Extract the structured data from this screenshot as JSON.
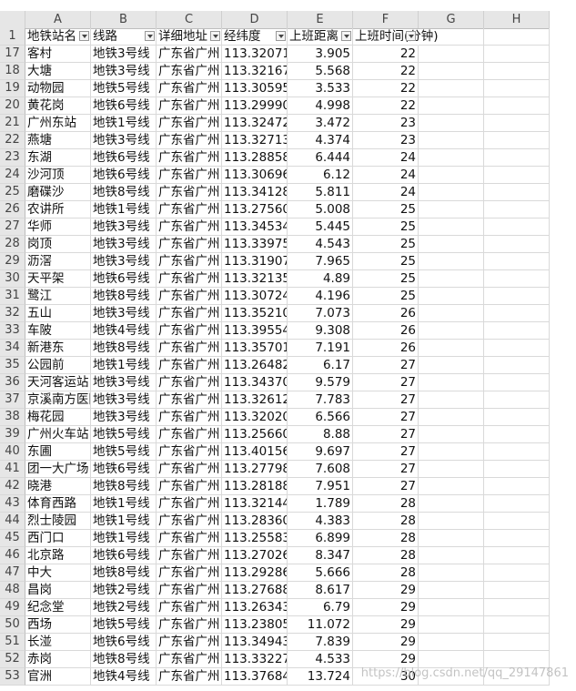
{
  "columns": [
    "A",
    "B",
    "C",
    "D",
    "E",
    "F",
    "G",
    "H"
  ],
  "header_row": {
    "row_number": "1",
    "cells": [
      "地铁站名",
      "线路",
      "详细地址",
      "经纬度",
      "上班距离",
      "上班时间(分钟)"
    ]
  },
  "rows": [
    {
      "n": "17",
      "name": "客村",
      "line": "地铁3号线",
      "addr": "广东省广州",
      "coord": "113.320716",
      "dist": "3.905",
      "time": "22"
    },
    {
      "n": "18",
      "name": "大塘",
      "line": "地铁3号线",
      "addr": "广东省广州",
      "coord": "113.321677",
      "dist": "5.568",
      "time": "22"
    },
    {
      "n": "19",
      "name": "动物园",
      "line": "地铁5号线",
      "addr": "广东省广州",
      "coord": "113.305951",
      "dist": "3.533",
      "time": "22"
    },
    {
      "n": "20",
      "name": "黄花岗",
      "line": "地铁6号线",
      "addr": "广东省广州",
      "coord": "113.299907",
      "dist": "4.998",
      "time": "22"
    },
    {
      "n": "21",
      "name": "广州东站",
      "line": "地铁1号线",
      "addr": "广东省广州",
      "coord": "113.324729",
      "dist": "3.472",
      "time": "23"
    },
    {
      "n": "22",
      "name": "燕塘",
      "line": "地铁3号线",
      "addr": "广东省广州",
      "coord": "113.327132",
      "dist": "4.374",
      "time": "23"
    },
    {
      "n": "23",
      "name": "东湖",
      "line": "地铁6号线",
      "addr": "广东省广州",
      "coord": "113.288583",
      "dist": "6.444",
      "time": "24"
    },
    {
      "n": "24",
      "name": "沙河顶",
      "line": "地铁6号线",
      "addr": "广东省广州",
      "coord": "113.306967",
      "dist": "6.12",
      "time": "24"
    },
    {
      "n": "25",
      "name": "磨碟沙",
      "line": "地铁8号线",
      "addr": "广东省广州",
      "coord": "113.341285",
      "dist": "5.811",
      "time": "24"
    },
    {
      "n": "26",
      "name": "农讲所",
      "line": "地铁1号线",
      "addr": "广东省广州",
      "coord": "113.275602",
      "dist": "5.008",
      "time": "25"
    },
    {
      "n": "27",
      "name": "华师",
      "line": "地铁3号线",
      "addr": "广东省广州",
      "coord": "113.345349",
      "dist": "5.445",
      "time": "25"
    },
    {
      "n": "28",
      "name": "岗顶",
      "line": "地铁3号线",
      "addr": "广东省广州",
      "coord": "113.339758",
      "dist": "4.543",
      "time": "25"
    },
    {
      "n": "29",
      "name": "沥滘",
      "line": "地铁3号线",
      "addr": "广东省广州",
      "coord": "113.319077",
      "dist": "7.965",
      "time": "25"
    },
    {
      "n": "30",
      "name": "天平架",
      "line": "地铁6号线",
      "addr": "广东省广州",
      "coord": "113.321353",
      "dist": "4.89",
      "time": "25"
    },
    {
      "n": "31",
      "name": "鹭江",
      "line": "地铁8号线",
      "addr": "广东省广州",
      "coord": "113.307242",
      "dist": "4.196",
      "time": "25"
    },
    {
      "n": "32",
      "name": "五山",
      "line": "地铁3号线",
      "addr": "广东省广州",
      "coord": "113.352100",
      "dist": "7.073",
      "time": "26"
    },
    {
      "n": "33",
      "name": "车陂",
      "line": "地铁4号线",
      "addr": "广东省广州",
      "coord": "113.395548",
      "dist": "9.308",
      "time": "26"
    },
    {
      "n": "34",
      "name": "新港东",
      "line": "地铁8号线",
      "addr": "广东省广州",
      "coord": "113.357016",
      "dist": "7.191",
      "time": "26"
    },
    {
      "n": "35",
      "name": "公园前",
      "line": "地铁1号线",
      "addr": "广东省广州",
      "coord": "113.264824",
      "dist": "6.17",
      "time": "27"
    },
    {
      "n": "36",
      "name": "天河客运站",
      "line": "地铁3号线",
      "addr": "广东省广州",
      "coord": "113.343702",
      "dist": "9.579",
      "time": "27"
    },
    {
      "n": "37",
      "name": "京溪南方医院",
      "line": "地铁3号线",
      "addr": "广东省广州",
      "coord": "113.326126",
      "dist": "7.783",
      "time": "27"
    },
    {
      "n": "38",
      "name": "梅花园",
      "line": "地铁3号线",
      "addr": "广东省广州",
      "coord": "113.320202",
      "dist": "6.566",
      "time": "27"
    },
    {
      "n": "39",
      "name": "广州火车站",
      "line": "地铁5号线",
      "addr": "广东省广州",
      "coord": "113.256603",
      "dist": "8.88",
      "time": "27"
    },
    {
      "n": "40",
      "name": "东圃",
      "line": "地铁5号线",
      "addr": "广东省广州",
      "coord": "113.401562",
      "dist": "9.697",
      "time": "27"
    },
    {
      "n": "41",
      "name": "团一大广场",
      "line": "地铁6号线",
      "addr": "广东省广州",
      "coord": "113.277989",
      "dist": "7.608",
      "time": "27"
    },
    {
      "n": "42",
      "name": "晓港",
      "line": "地铁8号线",
      "addr": "广东省广州",
      "coord": "113.281883",
      "dist": "7.951",
      "time": "27"
    },
    {
      "n": "43",
      "name": "体育西路",
      "line": "地铁1号线",
      "addr": "广东省广州",
      "coord": "113.321442",
      "dist": "1.789",
      "time": "28"
    },
    {
      "n": "44",
      "name": "烈士陵园",
      "line": "地铁1号线",
      "addr": "广东省广州",
      "coord": "113.283603",
      "dist": "4.383",
      "time": "28"
    },
    {
      "n": "45",
      "name": "西门口",
      "line": "地铁1号线",
      "addr": "广东省广州",
      "coord": "113.255830",
      "dist": "6.899",
      "time": "28"
    },
    {
      "n": "46",
      "name": "北京路",
      "line": "地铁6号线",
      "addr": "广东省广州",
      "coord": "113.270268",
      "dist": "8.347",
      "time": "28"
    },
    {
      "n": "47",
      "name": "中大",
      "line": "地铁8号线",
      "addr": "广东省广州",
      "coord": "113.292863",
      "dist": "5.666",
      "time": "28"
    },
    {
      "n": "48",
      "name": "昌岗",
      "line": "地铁2号线",
      "addr": "广东省广州",
      "coord": "113.276885",
      "dist": "8.617",
      "time": "29"
    },
    {
      "n": "49",
      "name": "纪念堂",
      "line": "地铁2号线",
      "addr": "广东省广州",
      "coord": "113.263431",
      "dist": "6.79",
      "time": "29"
    },
    {
      "n": "50",
      "name": "西场",
      "line": "地铁5号线",
      "addr": "广东省广州",
      "coord": "113.238056",
      "dist": "11.072",
      "time": "29"
    },
    {
      "n": "51",
      "name": "长湴",
      "line": "地铁6号线",
      "addr": "广东省广州",
      "coord": "113.349435",
      "dist": "7.839",
      "time": "29"
    },
    {
      "n": "52",
      "name": "赤岗",
      "line": "地铁8号线",
      "addr": "广东省广州",
      "coord": "113.332275",
      "dist": "4.533",
      "time": "29"
    },
    {
      "n": "53",
      "name": "官洲",
      "line": "地铁4号线",
      "addr": "广东省广州",
      "coord": "113.376840",
      "dist": "13.724",
      "time": "30"
    }
  ],
  "watermark": "https://blog.csdn.net/qq_29147861"
}
